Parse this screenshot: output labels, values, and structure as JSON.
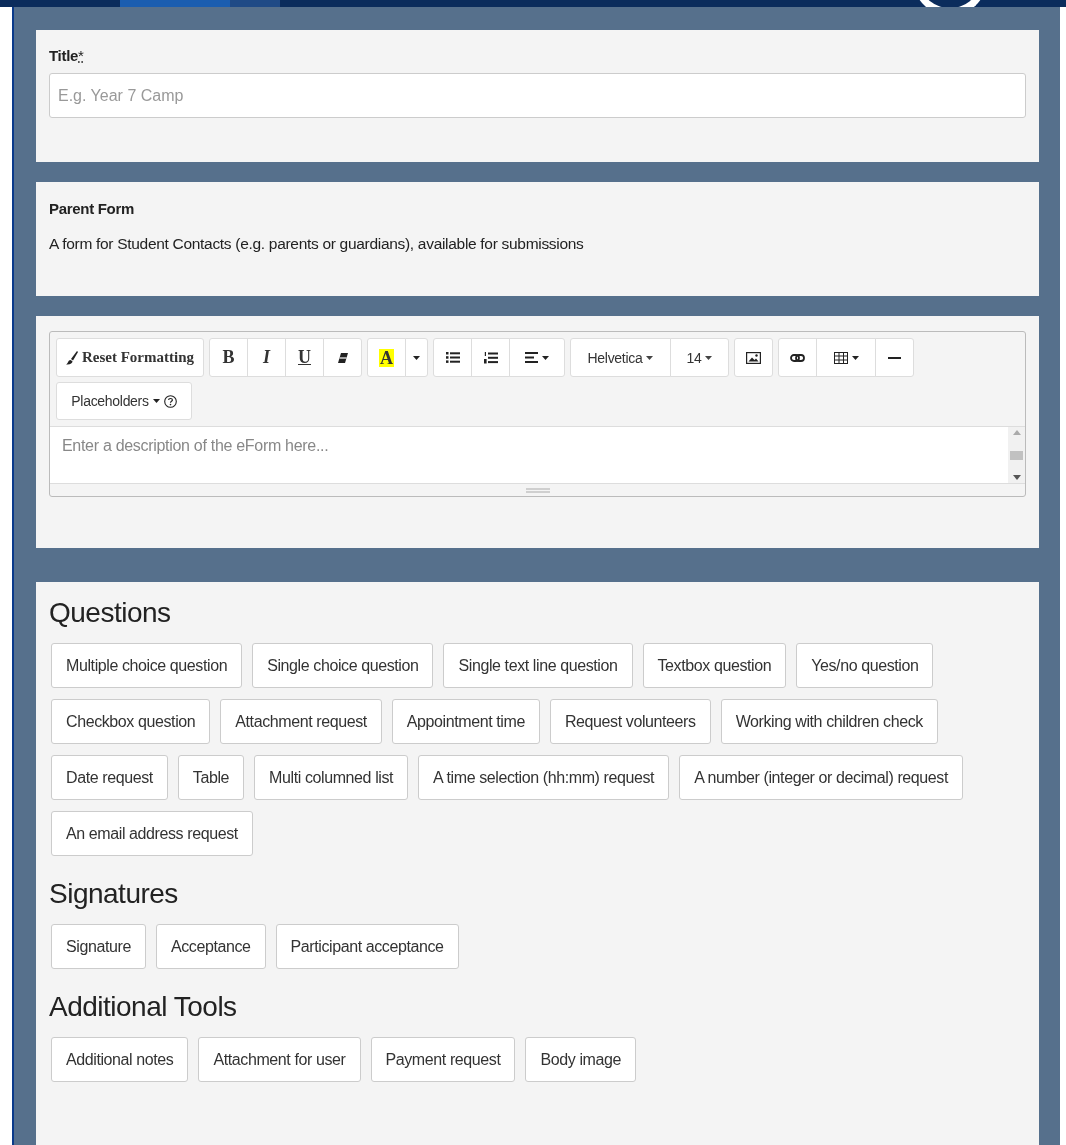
{
  "title_field": {
    "label": "Title",
    "required_mark": "*",
    "placeholder": "E.g. Year 7 Camp"
  },
  "parent_form": {
    "heading": "Parent Form",
    "description": "A form for Student Contacts (e.g. parents or guardians), available for submissions"
  },
  "editor": {
    "reset_label": "Reset Formatting",
    "bold_label": "B",
    "italic_label": "I",
    "underline_label": "U",
    "highlight_label": "A",
    "font_label": "Helvetica",
    "size_label": "14",
    "placeholders_label": "Placeholders",
    "placeholder": "Enter a description of the eForm here..."
  },
  "sections": [
    {
      "heading": "Questions",
      "buttons": [
        "Multiple choice question",
        "Single choice question",
        "Single text line question",
        "Textbox question",
        "Yes/no question",
        "Checkbox question",
        "Attachment request",
        "Appointment time",
        "Request volunteers",
        "Working with children check",
        "Date request",
        "Table",
        "Multi columned list",
        "A time selection (hh:mm) request",
        "A number (integer or decimal) request",
        "An email address request"
      ]
    },
    {
      "heading": "Signatures",
      "buttons": [
        "Signature",
        "Acceptance",
        "Participant acceptance"
      ]
    },
    {
      "heading": "Additional Tools",
      "buttons": [
        "Additional notes",
        "Attachment for user",
        "Payment request",
        "Body image"
      ]
    }
  ]
}
